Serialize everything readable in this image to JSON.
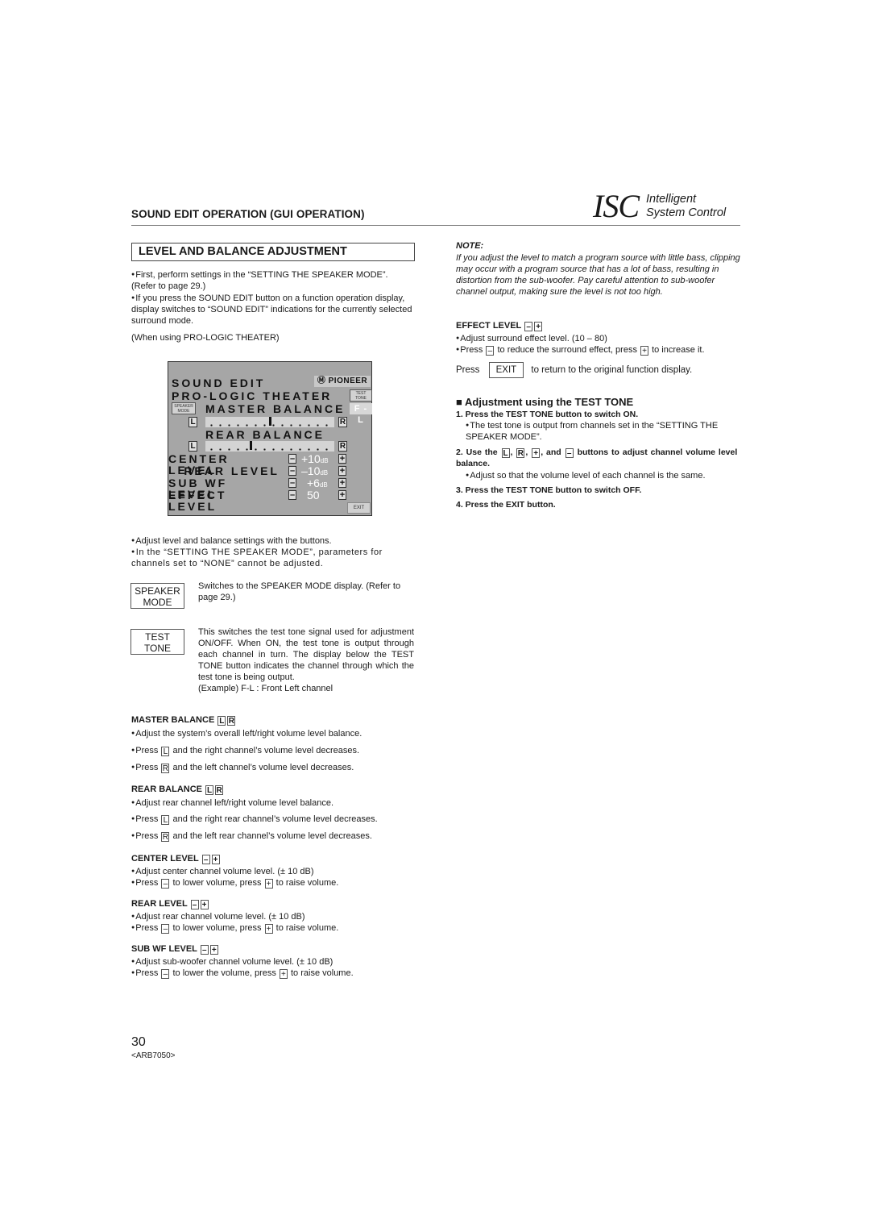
{
  "header": {
    "section_title": "SOUND EDIT OPERATION (GUI OPERATION)",
    "logo_big": "ISC",
    "logo_line1": "Intelligent",
    "logo_line2": "System Control"
  },
  "left": {
    "title": "LEVEL AND BALANCE ADJUSTMENT",
    "intro": [
      "First, perform settings in the “SETTING THE SPEAKER MODE”. (Refer to page 29.)",
      "If you press the SOUND EDIT button on a function operation display, display switches to “SOUND EDIT” indications for the currently selected surround mode."
    ],
    "when_using": "(When using PRO-LOGIC THEATER)",
    "gui": {
      "title": "SOUND EDIT",
      "brand": "PIONEER",
      "mode": "PRO-LOGIC THEATER",
      "test_tone_label": "TEST TONE",
      "speaker_mode_label": "SPEAKER MODE",
      "test_channel": "F - L",
      "master_balance_label": "MASTER BALANCE",
      "rear_balance_label": "REAR BALANCE",
      "left_key": "L",
      "right_key": "R",
      "master_balance_position": 0.5,
      "rear_balance_position": 0.35,
      "levels": [
        {
          "label": "CENTER LEVEL",
          "value": "+10",
          "unit": "dB"
        },
        {
          "label": "REAR LEVEL",
          "value": "–10",
          "unit": "dB"
        },
        {
          "label": "SUB WF LEVEL",
          "value": "+6",
          "unit": "dB"
        },
        {
          "label": "EFFECT LEVEL",
          "value": "50",
          "unit": ""
        }
      ],
      "minus": "–",
      "plus": "+",
      "exit": "EXIT"
    },
    "after_gui": [
      "Adjust level and balance settings with the buttons.",
      "In the “SETTING THE SPEAKER MODE”, parameters for channels set to “NONE” cannot be adjusted."
    ],
    "speaker_mode_key": {
      "line1": "SPEAKER",
      "line2": "MODE",
      "desc": "Switches to the SPEAKER MODE display. (Refer to page 29.)"
    },
    "test_tone_key": {
      "line1": "TEST",
      "line2": "TONE",
      "desc": "This switches the test tone signal used for adjustment ON/OFF. When ON, the test tone is output through each channel in turn. The display below the TEST TONE button indicates the channel through which the test tone is being output.",
      "example": "(Example) F-L : Front Left channel"
    },
    "master_balance": {
      "heading": "MASTER BALANCE",
      "desc": "Adjust the system’s overall left/right volume level balance.",
      "press": "Press",
      "l_text": "and the right channel’s volume level decreases.",
      "r_text": "and the left channel’s volume level decreases."
    },
    "rear_balance": {
      "heading": "REAR BALANCE",
      "desc": "Adjust rear channel left/right volume level balance.",
      "press": "Press",
      "l_text": "and the right rear channel’s volume level decreases.",
      "r_text": "and the left rear channel’s volume level decreases."
    },
    "center_level": {
      "heading": "CENTER LEVEL",
      "desc": "Adjust center channel volume level. (± 10 dB)",
      "press": "Press",
      "mid": "to lower volume, press",
      "end": "to raise volume."
    },
    "rear_level": {
      "heading": "REAR LEVEL",
      "desc": "Adjust rear channel volume level. (± 10 dB)",
      "press": "Press",
      "mid": "to lower volume, press",
      "end": "to raise volume."
    },
    "sub_wf_level": {
      "heading": "SUB WF LEVEL",
      "desc": "Adjust sub-woofer channel volume level. (± 10 dB)",
      "press": "Press",
      "mid": "to lower the volume, press",
      "end": "to raise volume."
    }
  },
  "right": {
    "note_title": "NOTE:",
    "note_body": "If you adjust the level to match a program source with little bass, clipping may occur with a program source that has a lot of bass, resulting in distortion from the sub-woofer. Pay careful attention to sub-woofer channel output, making sure the level is not too high.",
    "effect_level": {
      "heading": "EFFECT LEVEL",
      "desc": "Adjust surround effect level. (10 – 80)",
      "press": "Press",
      "mid": "to reduce the surround effect, press",
      "end": "to increase it."
    },
    "exit_line": {
      "press": "Press",
      "key": "EXIT",
      "text": "to return to the original function display."
    },
    "test_tone_heading": "Adjustment using the TEST TONE",
    "steps": {
      "s1": "1. Press the TEST TONE button to switch ON.",
      "s1_note": "The test tone is output from channels set in the “SETTING THE SPEAKER MODE”.",
      "s2_a": "2. Use the",
      "s2_b": "buttons to adjust channel volume level balance.",
      "s2_and": ", and",
      "s2_note": "Adjust so that the volume level of each channel is the same.",
      "s3": "3. Press the TEST TONE button to switch OFF.",
      "s4": "4. Press the EXIT button."
    }
  },
  "footer": {
    "page_number": "30",
    "doc_code": "<ARB7050>"
  }
}
